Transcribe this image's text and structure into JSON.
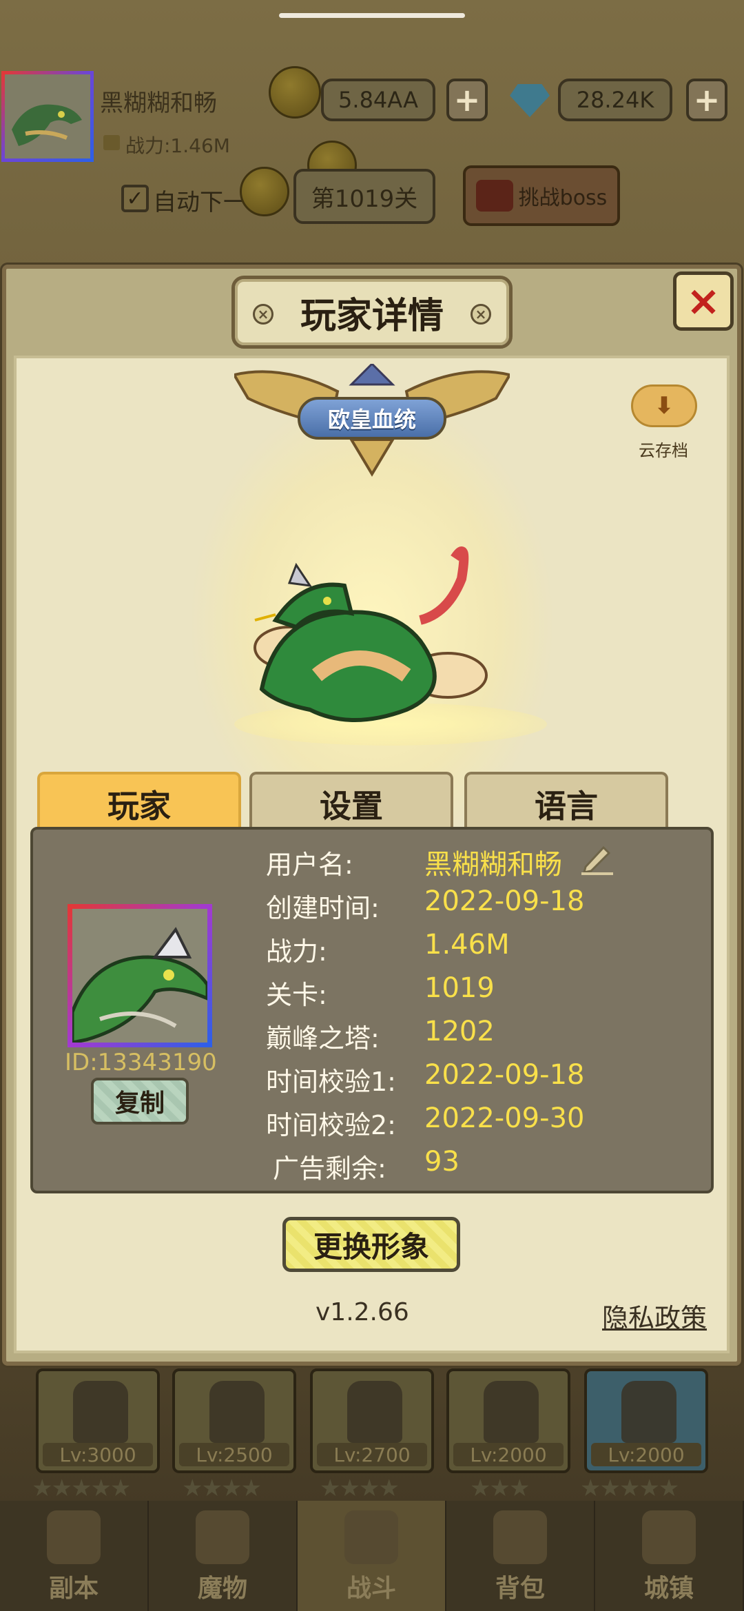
{
  "topbar": {
    "player_name": "黑糊糊和畅",
    "power": "战力:1.46M",
    "gold": "5.84AA",
    "gems": "28.24K",
    "plus_label": "+",
    "auto_next_label": "自动下一",
    "stage_label": "第1019关",
    "boss_label": "挑战boss"
  },
  "modal": {
    "title": "玩家详情",
    "badge": "欧皇血统",
    "cloud_save": "云存档",
    "close_icon": "×",
    "tabs": [
      {
        "label": "玩家",
        "active": true
      },
      {
        "label": "设置",
        "active": false
      },
      {
        "label": "语言",
        "active": false
      }
    ],
    "player_id": "ID:13343190",
    "copy_label": "复制",
    "rows": [
      {
        "label": "用户名:",
        "value": "黑糊糊和畅"
      },
      {
        "label": "创建时间:",
        "value": "2022-09-18"
      },
      {
        "label": "战力:",
        "value": "1.46M"
      },
      {
        "label": "关卡:",
        "value": "1019"
      },
      {
        "label": "巅峰之塔:",
        "value": "1202"
      },
      {
        "label": "时间校验1:",
        "value": "2022-09-18"
      },
      {
        "label": "时间校验2:",
        "value": "2022-09-30"
      },
      {
        "label": "广告剩余:",
        "value": "93"
      }
    ],
    "change_avatar_label": "更换形象",
    "version": "v1.2.66",
    "privacy_label": "隐私政策"
  },
  "heroes": [
    {
      "level": "Lv:3000",
      "stars": "★★★★★"
    },
    {
      "level": "Lv:2500",
      "stars": "★★★★"
    },
    {
      "level": "Lv:2700",
      "stars": "★★★★"
    },
    {
      "level": "Lv:2000",
      "stars": "★★★"
    },
    {
      "level": "Lv:2000",
      "stars": "★★★★★"
    }
  ],
  "nav": [
    {
      "label": "副本",
      "icon": "map-icon"
    },
    {
      "label": "魔物",
      "icon": "monster-icon"
    },
    {
      "label": "战斗",
      "icon": "swords-icon",
      "active": true
    },
    {
      "label": "背包",
      "icon": "backpack-icon"
    },
    {
      "label": "城镇",
      "icon": "town-icon"
    }
  ],
  "colors": {
    "value_yellow": "#f9e04a",
    "tab_active": "#f8c455",
    "close_red": "#c2221d",
    "id_gold": "#d7bf62"
  }
}
